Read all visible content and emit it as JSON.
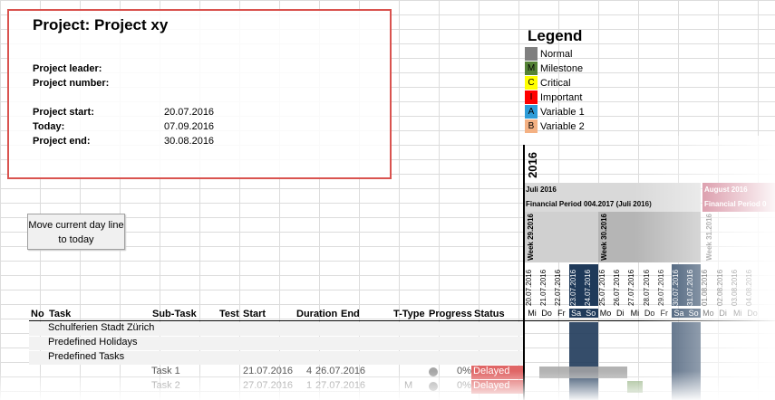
{
  "project": {
    "title": "Project: Project xy",
    "leader_label": "Project leader:",
    "number_label": "Project number:",
    "start_label": "Project start:",
    "start_value": "20.07.2016",
    "today_label": "Today:",
    "today_value": "07.09.2016",
    "end_label": "Project end:",
    "end_value": "30.08.2016"
  },
  "legend": {
    "title": "Legend",
    "items": [
      {
        "code": "",
        "label": "Normal",
        "color": "#7f7f7f"
      },
      {
        "code": "M",
        "label": "Milestone",
        "color": "#548235"
      },
      {
        "code": "C",
        "label": "Critical",
        "color": "#ffff00"
      },
      {
        "code": "I",
        "label": "Important",
        "color": "#ff0000"
      },
      {
        "code": "A",
        "label": "Variable 1",
        "color": "#2e9cd8"
      },
      {
        "code": "B",
        "label": "Variable 2",
        "color": "#f4b183"
      }
    ]
  },
  "button": {
    "label": "Move current day line to today"
  },
  "columns": {
    "no": "No",
    "task": "Task",
    "subtask": "Sub-Task",
    "test": "Test",
    "start": "Start",
    "duration": "Duration",
    "end": "End",
    "ttype": "T-Type",
    "progress": "Progress",
    "status": "Status"
  },
  "sections": [
    "Schulferien Stadt Zürich",
    "Predefined Holidays",
    "Predefined Tasks"
  ],
  "tasks": [
    {
      "subtask": "Task 1",
      "start": "21.07.2016",
      "duration": "4",
      "end": "26.07.2016",
      "ttype": "",
      "progress": "0%",
      "status": "Delayed"
    },
    {
      "subtask": "Task 2",
      "start": "27.07.2016",
      "duration": "1",
      "end": "27.07.2016",
      "ttype": "M",
      "progress": "0%",
      "status": "Delayed"
    }
  ],
  "gantt": {
    "year": "2016",
    "month1": "Juli 2016",
    "period1": "Financial Period 004.2017 (Juli 2016)",
    "month2": "August 2016",
    "period2": "Financial Period 0",
    "week1": "Week 29.2016",
    "week2": "Week 30.2016",
    "week3": "Week 31.2016",
    "dates": [
      "20.07.2016",
      "21.07.2016",
      "22.07.2016",
      "23.07.2016",
      "24.07.2016",
      "25.07.2016",
      "26.07.2016",
      "27.07.2016",
      "28.07.2016",
      "29.07.2016",
      "30.07.2016",
      "31.07.2016",
      "01.08.2016",
      "02.08.2016",
      "03.08.2016",
      "04.08.2016"
    ],
    "days": [
      "Mi",
      "Do",
      "Fr",
      "Sa",
      "So",
      "Mo",
      "Di",
      "Mi",
      "Do",
      "Fr",
      "Sa",
      "So",
      "Mo",
      "Di",
      "Mi",
      "Do"
    ],
    "weekend_color": "#1f3a5a",
    "month_color": "#d9d9d9",
    "month2_color": "#c0506b"
  }
}
